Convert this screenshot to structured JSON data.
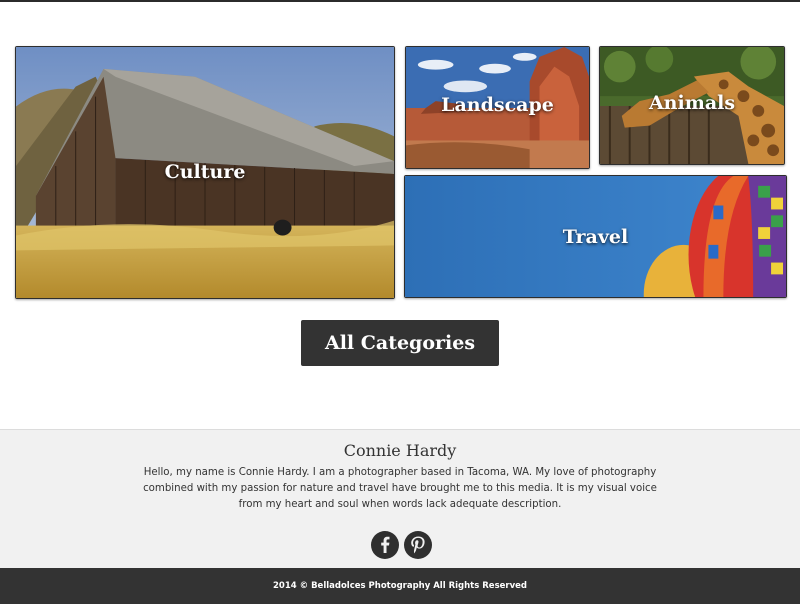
{
  "categories": {
    "culture": "Culture",
    "landscape": "Landscape",
    "animals": "Animals",
    "travel": "Travel"
  },
  "all_categories_label": "All Categories",
  "about": {
    "name": "Connie Hardy",
    "bio": "Hello, my name is Connie Hardy. I am a photographer based in Tacoma, WA. My love of photography combined with my passion for nature and travel have brought me to this media. It is my visual voice from my heart and soul when words lack adequate description."
  },
  "social": {
    "facebook_icon": "facebook-icon",
    "pinterest_icon": "pinterest-icon"
  },
  "footer": {
    "copyright": "2014 © Belladolces Photography All Rights Reserved"
  },
  "colors": {
    "dark": "#333333",
    "about_bg": "#f1f1f1",
    "travel_sky": "#2f78bf"
  }
}
